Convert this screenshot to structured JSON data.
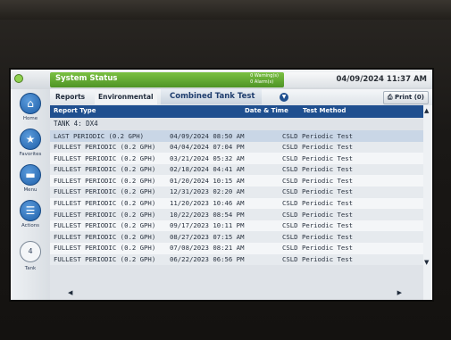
{
  "status": {
    "title": "System Status",
    "warnings": "0 Warning(s)",
    "alarms": "0 Alarm(s)",
    "datetime": "04/09/2024 11:37 AM"
  },
  "nav": {
    "home": "Home",
    "favorites": "Favorites",
    "menu": "Menu",
    "actions": "Actions",
    "tank_number": "4",
    "tank": "Tank"
  },
  "breadcrumb": {
    "reports": "Reports",
    "environmental": "Environmental",
    "active": "Combined Tank Test"
  },
  "toolbar": {
    "print": "Print (0)"
  },
  "icons": {
    "home": "home-icon",
    "favorites": "star-icon",
    "menu": "menu-icon",
    "actions": "list-icon",
    "dropdown": "chevron-down-icon",
    "print": "printer-icon"
  },
  "table": {
    "headers": {
      "type": "Report Type",
      "date": "Date & Time",
      "method": "Test Method"
    },
    "tank_label": "TANK 4: DX4",
    "rows": [
      {
        "type": "LAST PERIODIC (0.2 GPH)",
        "date": "04/09/2024 08:50 AM",
        "method": "CSLD Periodic Test"
      },
      {
        "type": "FULLEST PERIODIC (0.2 GPH)",
        "date": "04/04/2024 07:04 PM",
        "method": "CSLD Periodic Test"
      },
      {
        "type": "FULLEST PERIODIC (0.2 GPH)",
        "date": "03/21/2024 05:32 AM",
        "method": "CSLD Periodic Test"
      },
      {
        "type": "FULLEST PERIODIC (0.2 GPH)",
        "date": "02/18/2024 04:41 AM",
        "method": "CSLD Periodic Test"
      },
      {
        "type": "FULLEST PERIODIC (0.2 GPH)",
        "date": "01/20/2024 10:15 AM",
        "method": "CSLD Periodic Test"
      },
      {
        "type": "FULLEST PERIODIC (0.2 GPH)",
        "date": "12/31/2023 02:20 AM",
        "method": "CSLD Periodic Test"
      },
      {
        "type": "FULLEST PERIODIC (0.2 GPH)",
        "date": "11/20/2023 10:46 AM",
        "method": "CSLD Periodic Test"
      },
      {
        "type": "FULLEST PERIODIC (0.2 GPH)",
        "date": "10/22/2023 08:54 PM",
        "method": "CSLD Periodic Test"
      },
      {
        "type": "FULLEST PERIODIC (0.2 GPH)",
        "date": "09/17/2023 10:11 PM",
        "method": "CSLD Periodic Test"
      },
      {
        "type": "FULLEST PERIODIC (0.2 GPH)",
        "date": "08/27/2023 07:15 AM",
        "method": "CSLD Periodic Test"
      },
      {
        "type": "FULLEST PERIODIC (0.2 GPH)",
        "date": "07/08/2023 08:21 AM",
        "method": "CSLD Periodic Test"
      },
      {
        "type": "FULLEST PERIODIC (0.2 GPH)",
        "date": "06/22/2023 06:56 PM",
        "method": "CSLD Periodic Test"
      }
    ]
  },
  "colors": {
    "status_green": "#5aa330",
    "header_blue": "#1f4f8f",
    "nav_blue": "#2a6db8"
  }
}
